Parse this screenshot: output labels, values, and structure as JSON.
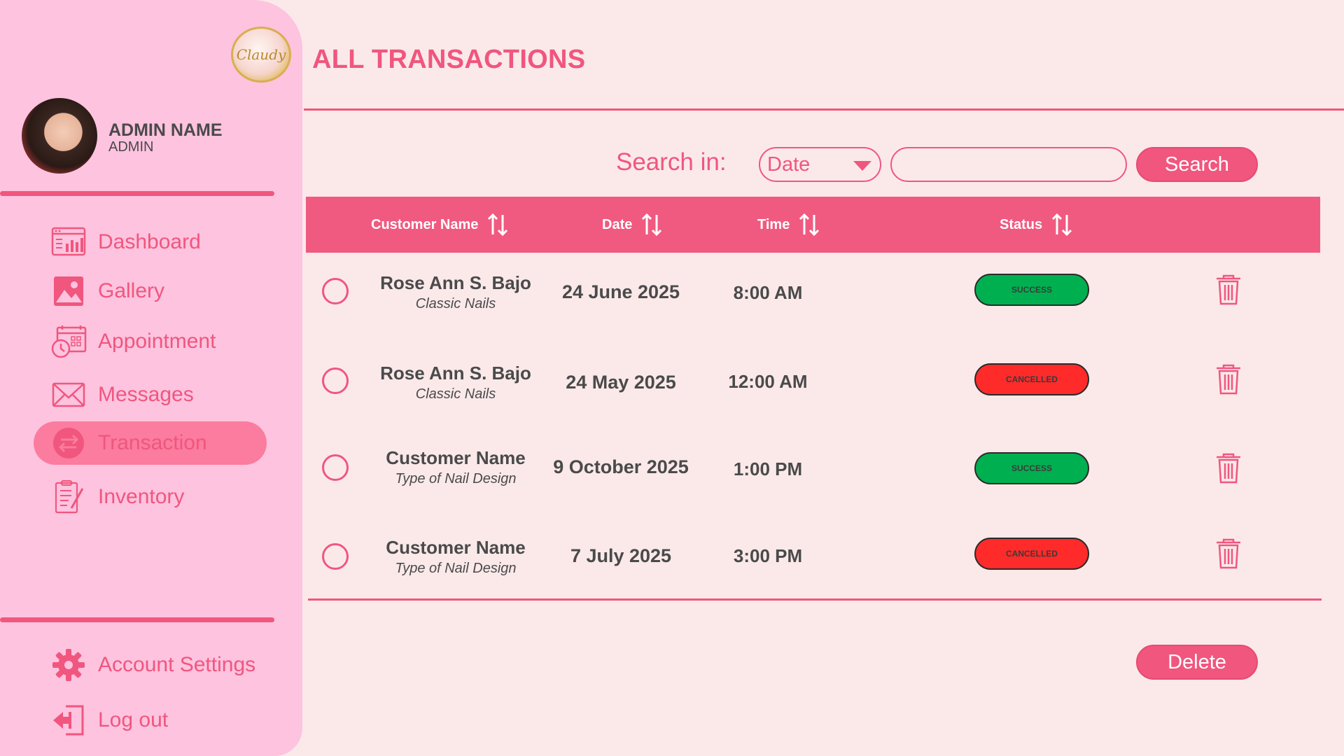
{
  "colors": {
    "accent": "#f0567e",
    "sidebar_bg": "#fdc3df",
    "page_bg": "#fbe9ea",
    "success": "#00b050",
    "cancelled": "#ff2a2a"
  },
  "brand": {
    "logo_icon": "nail-salon-logo-icon",
    "logo_text": "Claudy"
  },
  "user": {
    "name": "ADMIN NAME",
    "role": "ADMIN",
    "avatar_icon": "avatar-photo"
  },
  "nav": {
    "items": [
      {
        "label": "Dashboard",
        "icon": "dashboard-icon"
      },
      {
        "label": "Gallery",
        "icon": "gallery-icon"
      },
      {
        "label": "Appointment",
        "icon": "appointment-icon"
      },
      {
        "label": "Messages",
        "icon": "messages-icon"
      },
      {
        "label": "Transaction",
        "icon": "transaction-icon",
        "active": true
      },
      {
        "label": "Inventory",
        "icon": "inventory-icon"
      }
    ],
    "bottom": [
      {
        "label": "Account Settings",
        "icon": "gear-icon"
      },
      {
        "label": "Log out",
        "icon": "logout-icon"
      }
    ]
  },
  "page": {
    "title": "ALL TRANSACTIONS"
  },
  "search": {
    "label": "Search in:",
    "field_value": "Date",
    "input_value": "",
    "button_label": "Search"
  },
  "table": {
    "columns": [
      "Customer Name",
      "Date",
      "Time",
      "Status"
    ],
    "rows": [
      {
        "name": "Rose Ann S. Bajo",
        "service": "Classic Nails",
        "date": "24 June 2025",
        "time": "8:00 AM",
        "status": "SUCCESS"
      },
      {
        "name": "Rose Ann S. Bajo",
        "service": "Classic Nails",
        "date": "24 May 2025",
        "time": "12:00 AM",
        "status": "CANCELLED"
      },
      {
        "name": "Customer Name",
        "service": "Type of Nail Design",
        "date": "9 October 2025",
        "time": "1:00 PM",
        "status": "SUCCESS"
      },
      {
        "name": "Customer Name",
        "service": "Type of Nail Design",
        "date": "7 July 2025",
        "time": "3:00 PM",
        "status": "CANCELLED"
      }
    ]
  },
  "actions": {
    "delete_label": "Delete"
  }
}
